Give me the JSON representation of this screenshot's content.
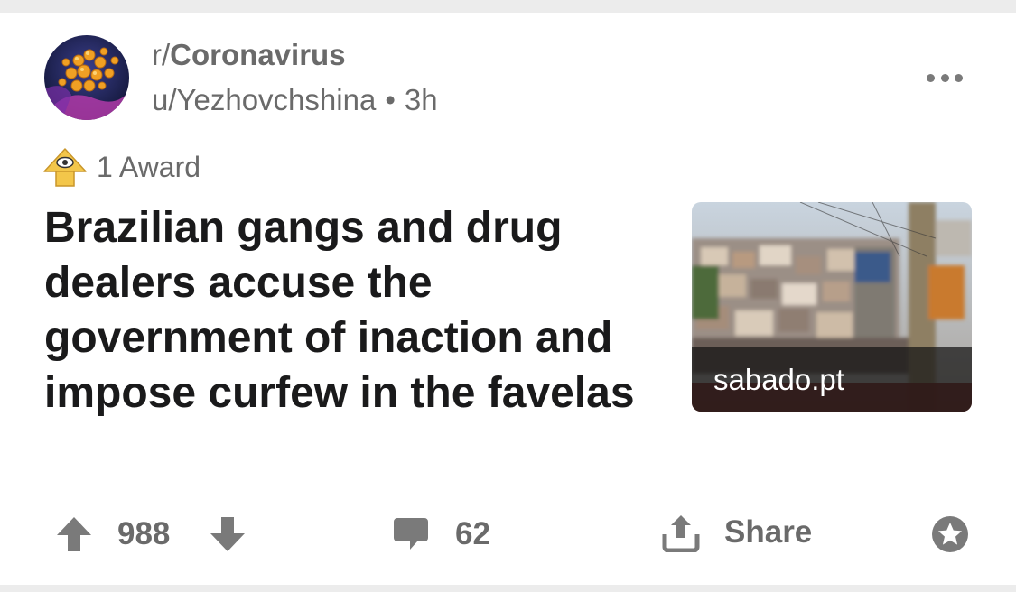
{
  "post": {
    "subreddit_prefix": "r/",
    "subreddit_name": "Coronavirus",
    "author": "u/Yezhovchshina",
    "separator": "•",
    "age": "3h",
    "awards_text": "1 Award",
    "title": "Brazilian gangs and drug dealers accuse the government of inaction and impose curfew in the favelas",
    "link_domain": "sabado.pt"
  },
  "actions": {
    "score": "988",
    "comments": "62",
    "share_label": "Share"
  },
  "icons": {
    "more": "more-options-icon",
    "award": "award-icon",
    "upvote": "upvote-arrow-icon",
    "downvote": "downvote-arrow-icon",
    "comment": "comment-bubble-icon",
    "share": "share-upload-icon",
    "give_award": "give-award-icon"
  },
  "colors": {
    "text_primary": "#1a1a1b",
    "text_secondary": "#6a6a6a",
    "icon_gray": "#7a7a7a",
    "award_gold": "#f3c64a"
  }
}
